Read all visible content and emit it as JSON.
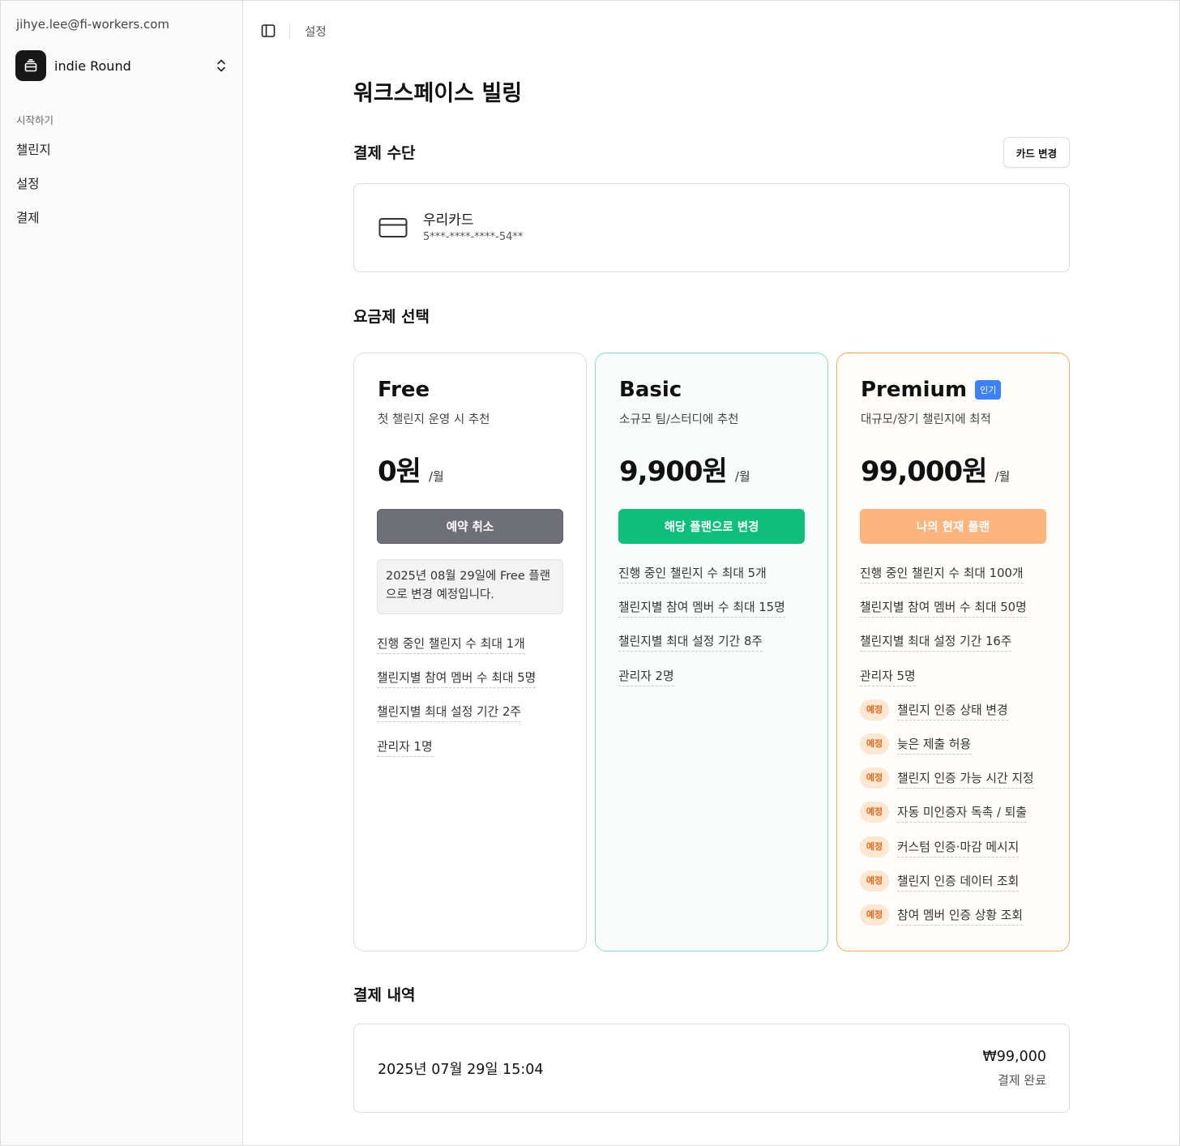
{
  "sidebar": {
    "user_email": "jihye.lee@fi-workers.com",
    "workspace_name": "indie Round",
    "section_label": "시작하기",
    "items": [
      {
        "label": "챌린지"
      },
      {
        "label": "설정"
      },
      {
        "label": "결제"
      }
    ]
  },
  "topbar": {
    "breadcrumb": "설정",
    "toggle_icon": "sidebar-toggle-icon"
  },
  "page": {
    "title": "워크스페이스 빌링"
  },
  "payment_method": {
    "heading": "결제 수단",
    "change_button": "카드 변경",
    "card_icon": "credit-card-icon",
    "card_name": "우리카드",
    "card_number": "5***-****-****-54**"
  },
  "plans_section": {
    "heading": "요금제 선택"
  },
  "plans": [
    {
      "name": "Free",
      "description": "첫 챌린지 운영 시 추천",
      "price": "0원",
      "unit": "/월",
      "button": "예약 취소",
      "notice": "2025년 08월 29일에 Free 플랜으로 변경 예정입니다.",
      "features": [
        {
          "text": "진행 중인 챌린지 수 최대 1개"
        },
        {
          "text": "챌린지별 참여 멤버 수 최대 5명"
        },
        {
          "text": "챌린지별 최대 설정 기간 2주"
        },
        {
          "text": "관리자 1명"
        }
      ]
    },
    {
      "name": "Basic",
      "description": "소규모 팀/스터디에 추천",
      "price": "9,900원",
      "unit": "/월",
      "button": "해당 플랜으로 변경",
      "features": [
        {
          "text": "진행 중인 챌린지 수 최대 5개"
        },
        {
          "text": "챌린지별 참여 멤버 수 최대 15명"
        },
        {
          "text": "챌린지별 최대 설정 기간 8주"
        },
        {
          "text": "관리자 2명"
        }
      ]
    },
    {
      "name": "Premium",
      "badge": "인기",
      "description": "대규모/장기 챌린지에 최적",
      "price": "99,000원",
      "unit": "/월",
      "button": "나의 현재 플랜",
      "features": [
        {
          "text": "진행 중인 챌린지 수 최대 100개"
        },
        {
          "text": "챌린지별 참여 멤버 수 최대 50명"
        },
        {
          "text": "챌린지별 최대 설정 기간 16주"
        },
        {
          "text": "관리자 5명"
        },
        {
          "tag": "예정",
          "text": "챌린지 인증 상태 변경"
        },
        {
          "tag": "예정",
          "text": "늦은 제출 허용"
        },
        {
          "tag": "예정",
          "text": "챌린지 인증 가능 시간 지정"
        },
        {
          "tag": "예정",
          "text": "자동 미인증자 독촉 / 퇴출"
        },
        {
          "tag": "예정",
          "text": "커스텀 인증·마감 메시지"
        },
        {
          "tag": "예정",
          "text": "챌린지 인증 데이터 조회"
        },
        {
          "tag": "예정",
          "text": "참여 멤버 인증 상황 조회"
        }
      ]
    }
  ],
  "history": {
    "heading": "결제 내역",
    "items": [
      {
        "date": "2025년 07월 29일 15:04",
        "amount": "₩99,000",
        "status": "결제 완료"
      }
    ]
  },
  "colors": {
    "basic_accent": "#0ebf7b",
    "premium_accent": "#f5a862",
    "popular_badge": "#3b82f6",
    "cancel_button": "#6f6f78"
  }
}
